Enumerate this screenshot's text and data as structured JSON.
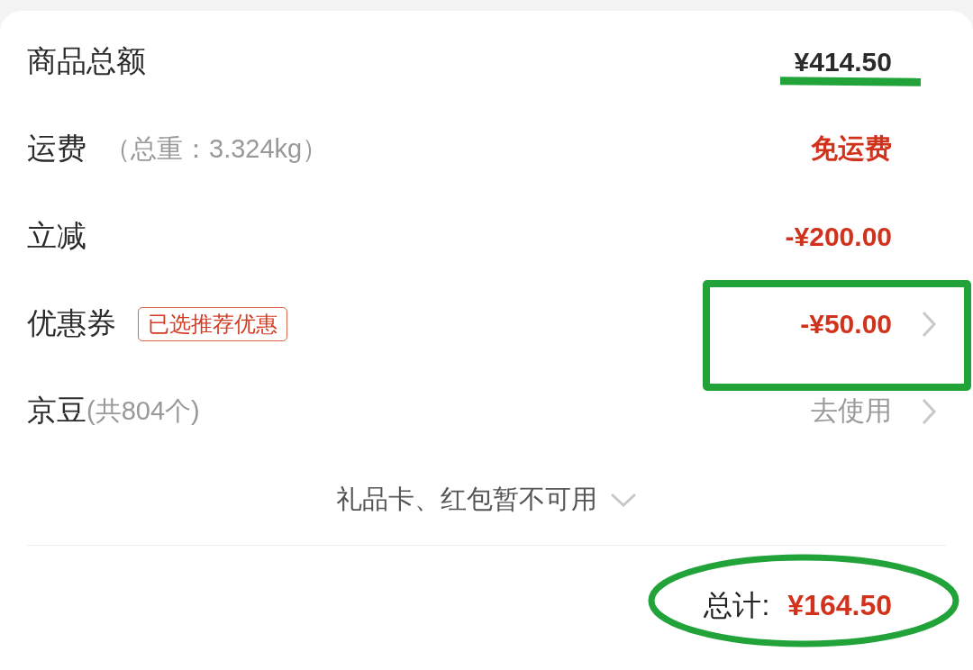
{
  "rows": [
    {
      "label": "商品总额",
      "value": "¥414.50",
      "kind": "amount",
      "chevron": false,
      "underlined": true,
      "boxed": false
    },
    {
      "label": "运费",
      "note": "（总重：3.324kg）",
      "value": "免运费",
      "kind": "discount",
      "chevron": false,
      "underlined": false,
      "boxed": false
    },
    {
      "label": "立减",
      "value": "-¥200.00",
      "kind": "discount",
      "chevron": false,
      "underlined": false,
      "boxed": false
    },
    {
      "label": "优惠券",
      "badge": "已选推荐优惠",
      "value": "-¥50.00",
      "kind": "discount",
      "chevron": true,
      "underlined": false,
      "boxed": true
    },
    {
      "label": "京豆",
      "note": "(共804个)",
      "value": "去使用",
      "kind": "action",
      "chevron": true,
      "underlined": false,
      "boxed": false
    }
  ],
  "notice": {
    "text": "礼品卡、红包暂不可用",
    "expanded": false
  },
  "total": {
    "label": "总计:",
    "value": "¥164.50",
    "circled": true
  }
}
